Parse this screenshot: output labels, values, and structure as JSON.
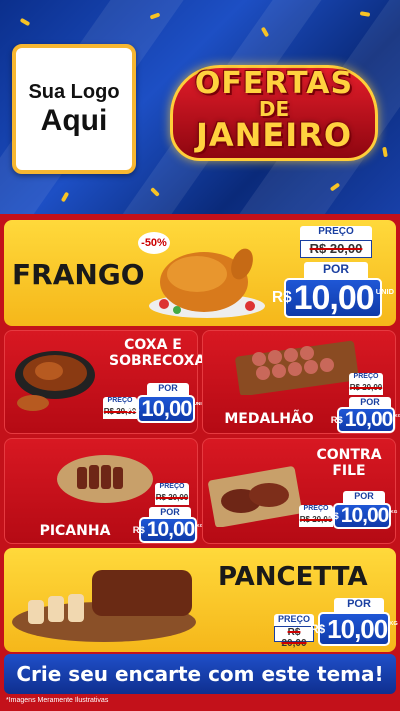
{
  "logo": {
    "line1": "Sua Logo",
    "line2": "Aqui"
  },
  "title": {
    "line1": "OFERTAS",
    "line2": "DE",
    "line3": "JANEIRO"
  },
  "products": {
    "frango": {
      "name": "FRANGO",
      "discount": "-50%",
      "preco_label": "PREÇO",
      "old_price": "R$ 20,00",
      "por_label": "POR",
      "currency": "R$",
      "price": "10,00",
      "unit": "UNID"
    },
    "coxa": {
      "name_line1": "COXA E",
      "name_line2": "SOBRECOXA",
      "preco_label": "PREÇO",
      "old_price": "R$ 20,00",
      "por_label": "POR",
      "currency": "R$",
      "price": "10,00",
      "unit": "UNID"
    },
    "medalhao": {
      "name": "MEDALHÃO",
      "preco_label": "PREÇO",
      "old_price": "R$ 20,00",
      "por_label": "POR",
      "currency": "R$",
      "price": "10,00",
      "unit": "KG"
    },
    "picanha": {
      "name": "PICANHA",
      "preco_label": "PREÇO",
      "old_price": "R$ 20,00",
      "por_label": "POR",
      "currency": "R$",
      "price": "10,00",
      "unit": "KG"
    },
    "contrafile": {
      "name_line1": "CONTRA",
      "name_line2": "FILE",
      "preco_label": "PREÇO",
      "old_price": "R$ 20,00",
      "por_label": "POR",
      "currency": "R$",
      "price": "10,00",
      "unit": "KG"
    },
    "pancetta": {
      "name": "PANCETTA",
      "preco_label": "PREÇO",
      "old_price": "R$ 20,00",
      "por_label": "POR",
      "currency": "R$",
      "price": "10,00",
      "unit": "KG"
    }
  },
  "cta": "Crie seu encarte com este tema!",
  "footnote": "*Imagens Meramente Ilustrativas",
  "colors": {
    "red": "#c3111a",
    "yellow": "#f7c325",
    "blue": "#1a3fa0"
  }
}
